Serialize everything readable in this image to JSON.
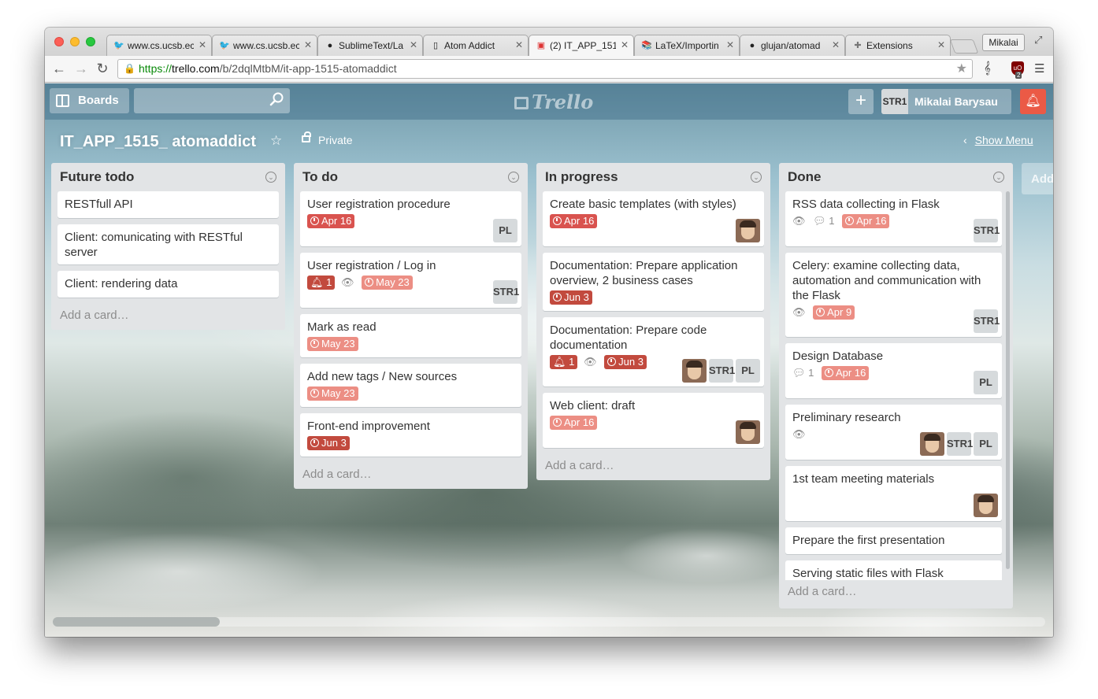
{
  "browser": {
    "tabs": [
      {
        "label": "www.cs.ucsb.ec",
        "icon": "ucsb-favicon"
      },
      {
        "label": "www.cs.ucsb.ec",
        "icon": "ucsb-favicon"
      },
      {
        "label": "SublimeText/La",
        "icon": "github-favicon"
      },
      {
        "label": "Atom Addict",
        "icon": "page-favicon"
      },
      {
        "label": "(2) IT_APP_151",
        "icon": "trello-favicon"
      },
      {
        "label": "LaTeX/Importin",
        "icon": "wikibooks-favicon"
      },
      {
        "label": "glujan/atomad",
        "icon": "github-favicon"
      },
      {
        "label": "Extensions",
        "icon": "puzzle-favicon"
      }
    ],
    "profile": "Mikalai",
    "url_scheme": "https://",
    "url_host": "trello.com",
    "url_path": "/b/2dqlMtbM/it-app-1515-atomaddict",
    "ublock_badge": "2"
  },
  "header": {
    "boards_label": "Boards",
    "logo_text": "Trello",
    "member_initials": "STR1",
    "member_name": "Mikalai Barysau"
  },
  "board": {
    "title": "IT_APP_1515_ atomaddict",
    "visibility": "Private",
    "show_menu": "Show Menu",
    "add_list": "Add"
  },
  "lists": [
    {
      "title": "Future todo",
      "add_card": "Add a card…",
      "cards": [
        {
          "title": "RESTfull API"
        },
        {
          "title": "Client: comunicating with RESTful server"
        },
        {
          "title": "Client: rendering data"
        }
      ]
    },
    {
      "title": "To do",
      "add_card": "Add a card…",
      "cards": [
        {
          "title": "User registration procedure",
          "due": "Apr 16",
          "members": [
            "PL"
          ]
        },
        {
          "title": "User registration / Log in",
          "alert": "1",
          "due": "May 23",
          "members": [
            "STR1"
          ]
        },
        {
          "title": "Mark as read",
          "due": "May 23"
        },
        {
          "title": "Add new tags / New sources",
          "due": "May 23"
        },
        {
          "title": "Front-end improvement",
          "due": "Jun 3"
        }
      ]
    },
    {
      "title": "In progress",
      "add_card": "Add a card…",
      "cards": [
        {
          "title": "Create basic templates (with styles)",
          "due": "Apr 16"
        },
        {
          "title": "Documentation: Prepare application overview, 2 business cases",
          "due": "Jun 3"
        },
        {
          "title": "Documentation: Prepare code documentation",
          "alert": "1",
          "due": "Jun 3",
          "members": [
            "STR1",
            "PL"
          ]
        },
        {
          "title": "Web client: draft",
          "due": "Apr 16"
        }
      ]
    },
    {
      "title": "Done",
      "add_card": "Add a card…",
      "cards": [
        {
          "title": "RSS data collecting in Flask",
          "comments": "1",
          "due": "Apr 16",
          "members": [
            "STR1"
          ]
        },
        {
          "title": "Celery: examine collecting data, automation and communication with the Flask",
          "due": "Apr 9",
          "members": [
            "STR1"
          ]
        },
        {
          "title": "Design Database",
          "comments": "1",
          "due": "Apr 16",
          "members": [
            "PL"
          ]
        },
        {
          "title": "Preliminary research",
          "members": [
            "STR1",
            "PL"
          ]
        },
        {
          "title": "1st team meeting materials"
        },
        {
          "title": "Prepare the first presentation"
        },
        {
          "title": "Serving static files with Flask"
        }
      ]
    }
  ],
  "colors": {
    "due_soon": "#ec8e84",
    "due_overdue": "#d9534f",
    "notification": "#eb5a46",
    "list_bg": "#e2e4e6"
  }
}
